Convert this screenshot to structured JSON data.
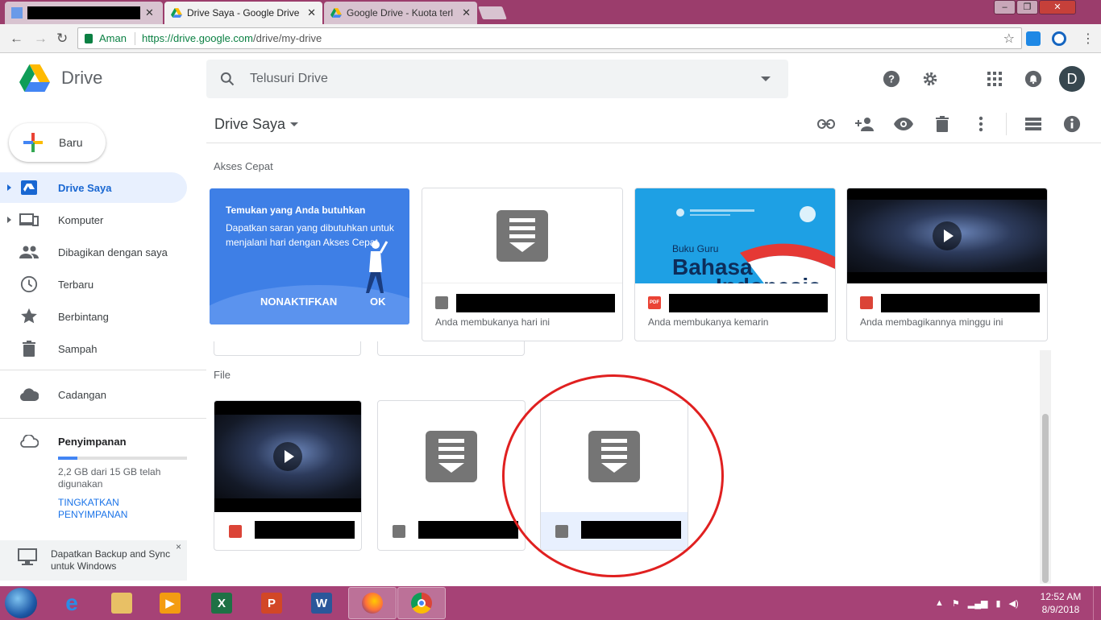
{
  "browser": {
    "tabs": [
      {
        "title": "",
        "redacted": true
      },
      {
        "title": "Drive Saya - Google Drive"
      },
      {
        "title": "Google Drive - Kuota terl"
      }
    ],
    "window_controls": {
      "minimize": "–",
      "restore": "❐",
      "close": "✕"
    },
    "secure_label": "Aman",
    "url_origin": "https://drive.google.com",
    "url_path": "/drive/my-drive"
  },
  "header": {
    "logo_text": "Drive",
    "search_placeholder": "Telusuri Drive",
    "avatar_letter": "D"
  },
  "sidebar": {
    "new_label": "Baru",
    "items": [
      {
        "label": "Drive Saya",
        "icon": "drive-icon",
        "active": true
      },
      {
        "label": "Komputer",
        "icon": "computer-icon"
      },
      {
        "label": "Dibagikan dengan saya",
        "icon": "people-icon"
      },
      {
        "label": "Terbaru",
        "icon": "clock-icon"
      },
      {
        "label": "Berbintang",
        "icon": "star-icon"
      },
      {
        "label": "Sampah",
        "icon": "trash-icon"
      }
    ],
    "backup_label": "Cadangan",
    "storage_label": "Penyimpanan",
    "storage_usage": "2,2 GB dari 15 GB telah digunakan",
    "storage_used_fraction": 0.147,
    "upgrade_label": "TINGKATKAN PENYIMPANAN",
    "backup_promo": "Dapatkan Backup and Sync untuk Windows",
    "backup_close": "×"
  },
  "main": {
    "title": "Drive Saya",
    "quick_access_label": "Akses Cepat",
    "files_label": "File",
    "promo": {
      "title": "Temukan yang Anda butuhkan",
      "body": "Dapatkan saran yang dibutuhkan untuk menjalani hari dengan Akses Cepat",
      "disable": "NONAKTIFKAN",
      "ok": "OK"
    },
    "quick_cards": [
      {
        "type": "doc",
        "subtitle": "Anda membukanya hari ini"
      },
      {
        "type": "pdf",
        "subtitle": "Anda membukanya kemarin",
        "thumb_label": "Buku Guru",
        "thumb_title": "Bahasa",
        "thumb_title2": "Indonesia"
      },
      {
        "type": "video",
        "subtitle": "Anda membagikannya minggu ini"
      }
    ],
    "files": [
      {
        "type": "video"
      },
      {
        "type": "doc"
      },
      {
        "type": "doc",
        "selected": true
      }
    ]
  },
  "taskbar": {
    "time": "12:52 AM",
    "date": "8/9/2018"
  },
  "colors": {
    "accent": "#1a73e8",
    "active_bg": "#e8f0fe",
    "taskbar": "#a64276",
    "annotation": "#e02020"
  }
}
